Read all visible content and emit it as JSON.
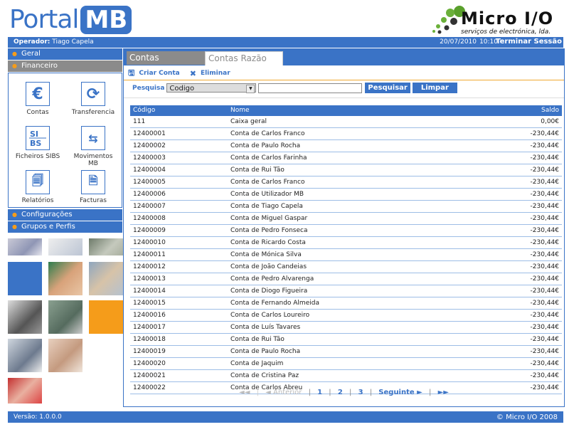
{
  "header": {
    "logo_portal": "Portal",
    "logo_mb": "MB",
    "brand_name": "Micro I/O",
    "brand_sub": "serviços de electrónica, lda."
  },
  "topbar": {
    "operator_label": "Operador:",
    "operator_name": "Tiago Capela",
    "date": "20/07/2010",
    "time": "10:10",
    "logout": "Terminar Sessão"
  },
  "sidebar": {
    "geral": "Geral",
    "financeiro": "Financeiro",
    "configuracoes": "Configurações",
    "grupos": "Grupos e Perfis",
    "icons": [
      {
        "label": "Contas",
        "icon": "euro-icon"
      },
      {
        "label": "Transferencia",
        "icon": "refresh-icon"
      },
      {
        "label": "Ficheiros SIBS",
        "icon": "sibs-icon"
      },
      {
        "label": "Movimentos MB",
        "icon": "transfer-arrows-icon"
      },
      {
        "label": "Relatórios",
        "icon": "reports-icon"
      },
      {
        "label": "Facturas",
        "icon": "invoice-icon"
      }
    ]
  },
  "tabs": {
    "active": "Contas",
    "inactive": "Contas Razão"
  },
  "toolbar": {
    "create": "Criar Conta",
    "delete": "Eliminar"
  },
  "search": {
    "label": "Pesquisa",
    "field_value": "Codigo",
    "input_value": "",
    "search_btn": "Pesquisar",
    "clear_btn": "Limpar"
  },
  "table": {
    "headers": [
      "Código",
      "Nome",
      "Saldo"
    ],
    "rows": [
      [
        "111",
        "Caixa geral",
        "0,00€"
      ],
      [
        "12400001",
        "Conta de Carlos Franco",
        "-230,44€"
      ],
      [
        "12400002",
        "Conta de Paulo Rocha",
        "-230,44€"
      ],
      [
        "12400003",
        "Conta de Carlos Farinha",
        "-230,44€"
      ],
      [
        "12400004",
        "Conta de Rui Tão",
        "-230,44€"
      ],
      [
        "12400005",
        "Conta de Carlos Franco",
        "-230,44€"
      ],
      [
        "12400006",
        "Conta de Utilizador MB",
        "-230,44€"
      ],
      [
        "12400007",
        "Conta de Tiago Capela",
        "-230,44€"
      ],
      [
        "12400008",
        "Conta de Miguel Gaspar",
        "-230,44€"
      ],
      [
        "12400009",
        "Conta de Pedro Fonseca",
        "-230,44€"
      ],
      [
        "12400010",
        "Conta de Ricardo Costa",
        "-230,44€"
      ],
      [
        "12400011",
        "Conta de Mónica Silva",
        "-230,44€"
      ],
      [
        "12400012",
        "Conta de João Candeias",
        "-230,44€"
      ],
      [
        "12400013",
        "Conta de Pedro Alvarenga",
        "-230,44€"
      ],
      [
        "12400014",
        "Conta de Diogo Figueira",
        "-230,44€"
      ],
      [
        "12400015",
        "Conta de Fernando Almeida",
        "-230,44€"
      ],
      [
        "12400016",
        "Conta de Carlos Loureiro",
        "-230,44€"
      ],
      [
        "12400017",
        "Conta de Luís Tavares",
        "-230,44€"
      ],
      [
        "12400018",
        "Conta de Rui Tão",
        "-230,44€"
      ],
      [
        "12400019",
        "Conta de Paulo Rocha",
        "-230,44€"
      ],
      [
        "12400020",
        "Conta de Jaquim",
        "-230,44€"
      ],
      [
        "12400021",
        "Conta de Cristina Paz",
        "-230,44€"
      ],
      [
        "12400022",
        "Conta de Carlos Abreu",
        "-230,44€"
      ]
    ]
  },
  "pager": {
    "first": "◄◄",
    "prev": "◄ Anterior",
    "pages": [
      "1",
      "2",
      "3"
    ],
    "next": "Seguinte ►",
    "last": "►►"
  },
  "footer": {
    "version": "Versão: 1.0.0.0",
    "copyright": "© Micro I/O 2008"
  },
  "colors": {
    "primary": "#3a73c6",
    "grey_tab": "#8b8b8b",
    "accent_orange": "#f59c1a",
    "green_logo": "#5aa02c"
  }
}
